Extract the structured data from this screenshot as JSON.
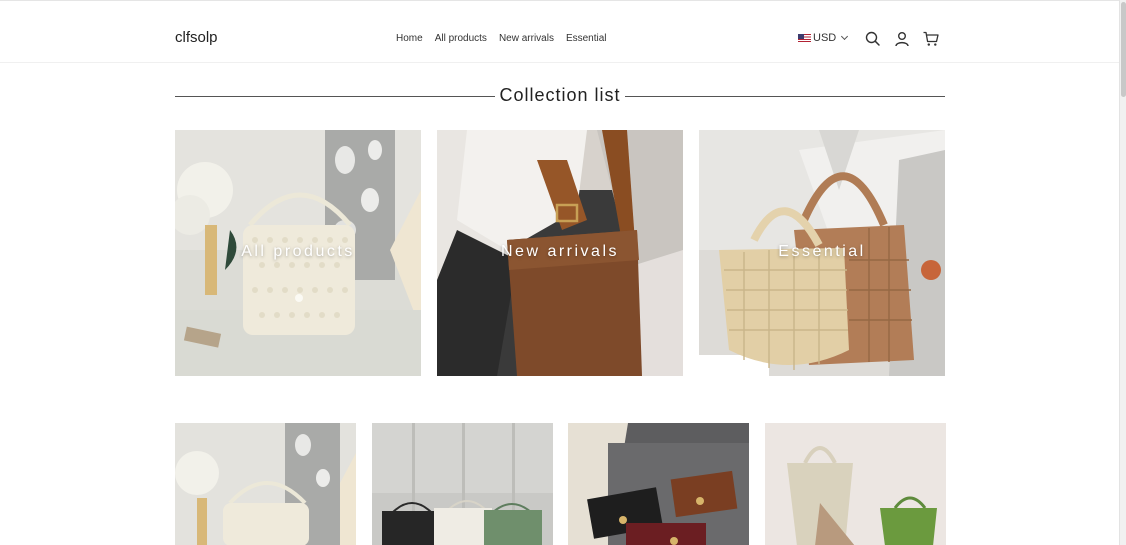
{
  "header": {
    "logo": "clfsolp",
    "nav": [
      "Home",
      "All products",
      "New arrivals",
      "Essential"
    ],
    "currency": "USD"
  },
  "section": {
    "title": "Collection list"
  },
  "collections": [
    {
      "label": "All products"
    },
    {
      "label": "New arrivals"
    },
    {
      "label": "Essential"
    }
  ],
  "colors": {
    "text": "#222222",
    "tile_label": "#ffffff",
    "divider": "#555555"
  },
  "icons": [
    "search-icon",
    "account-icon",
    "cart-icon",
    "chevron-down-icon",
    "us-flag-icon"
  ]
}
